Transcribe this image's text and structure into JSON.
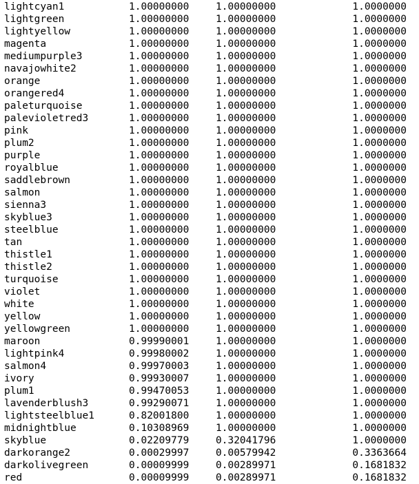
{
  "output": {
    "rows": [
      [
        "lightcyan1",
        "1.00000000",
        "1.00000000",
        "1.0000000"
      ],
      [
        "lightgreen",
        "1.00000000",
        "1.00000000",
        "1.0000000"
      ],
      [
        "lightyellow",
        "1.00000000",
        "1.00000000",
        "1.0000000"
      ],
      [
        "magenta",
        "1.00000000",
        "1.00000000",
        "1.0000000"
      ],
      [
        "mediumpurple3",
        "1.00000000",
        "1.00000000",
        "1.0000000"
      ],
      [
        "navajowhite2",
        "1.00000000",
        "1.00000000",
        "1.0000000"
      ],
      [
        "orange",
        "1.00000000",
        "1.00000000",
        "1.0000000"
      ],
      [
        "orangered4",
        "1.00000000",
        "1.00000000",
        "1.0000000"
      ],
      [
        "paleturquoise",
        "1.00000000",
        "1.00000000",
        "1.0000000"
      ],
      [
        "palevioletred3",
        "1.00000000",
        "1.00000000",
        "1.0000000"
      ],
      [
        "pink",
        "1.00000000",
        "1.00000000",
        "1.0000000"
      ],
      [
        "plum2",
        "1.00000000",
        "1.00000000",
        "1.0000000"
      ],
      [
        "purple",
        "1.00000000",
        "1.00000000",
        "1.0000000"
      ],
      [
        "royalblue",
        "1.00000000",
        "1.00000000",
        "1.0000000"
      ],
      [
        "saddlebrown",
        "1.00000000",
        "1.00000000",
        "1.0000000"
      ],
      [
        "salmon",
        "1.00000000",
        "1.00000000",
        "1.0000000"
      ],
      [
        "sienna3",
        "1.00000000",
        "1.00000000",
        "1.0000000"
      ],
      [
        "skyblue3",
        "1.00000000",
        "1.00000000",
        "1.0000000"
      ],
      [
        "steelblue",
        "1.00000000",
        "1.00000000",
        "1.0000000"
      ],
      [
        "tan",
        "1.00000000",
        "1.00000000",
        "1.0000000"
      ],
      [
        "thistle1",
        "1.00000000",
        "1.00000000",
        "1.0000000"
      ],
      [
        "thistle2",
        "1.00000000",
        "1.00000000",
        "1.0000000"
      ],
      [
        "turquoise",
        "1.00000000",
        "1.00000000",
        "1.0000000"
      ],
      [
        "violet",
        "1.00000000",
        "1.00000000",
        "1.0000000"
      ],
      [
        "white",
        "1.00000000",
        "1.00000000",
        "1.0000000"
      ],
      [
        "yellow",
        "1.00000000",
        "1.00000000",
        "1.0000000"
      ],
      [
        "yellowgreen",
        "1.00000000",
        "1.00000000",
        "1.0000000"
      ],
      [
        "maroon",
        "0.99990001",
        "1.00000000",
        "1.0000000"
      ],
      [
        "lightpink4",
        "0.99980002",
        "1.00000000",
        "1.0000000"
      ],
      [
        "salmon4",
        "0.99970003",
        "1.00000000",
        "1.0000000"
      ],
      [
        "ivory",
        "0.99930007",
        "1.00000000",
        "1.0000000"
      ],
      [
        "plum1",
        "0.99470053",
        "1.00000000",
        "1.0000000"
      ],
      [
        "lavenderblush3",
        "0.99290071",
        "1.00000000",
        "1.0000000"
      ],
      [
        "lightsteelblue1",
        "0.82001800",
        "1.00000000",
        "1.0000000"
      ],
      [
        "midnightblue",
        "0.10308969",
        "1.00000000",
        "1.0000000"
      ],
      [
        "skyblue",
        "0.02209779",
        "0.32041796",
        "1.0000000"
      ],
      [
        "darkorange2",
        "0.00029997",
        "0.00579942",
        "0.3363664"
      ],
      [
        "darkolivegreen",
        "0.00009999",
        "0.00289971",
        "0.1681832"
      ],
      [
        "red",
        "0.00009999",
        "0.00289971",
        "0.1681832"
      ]
    ]
  }
}
